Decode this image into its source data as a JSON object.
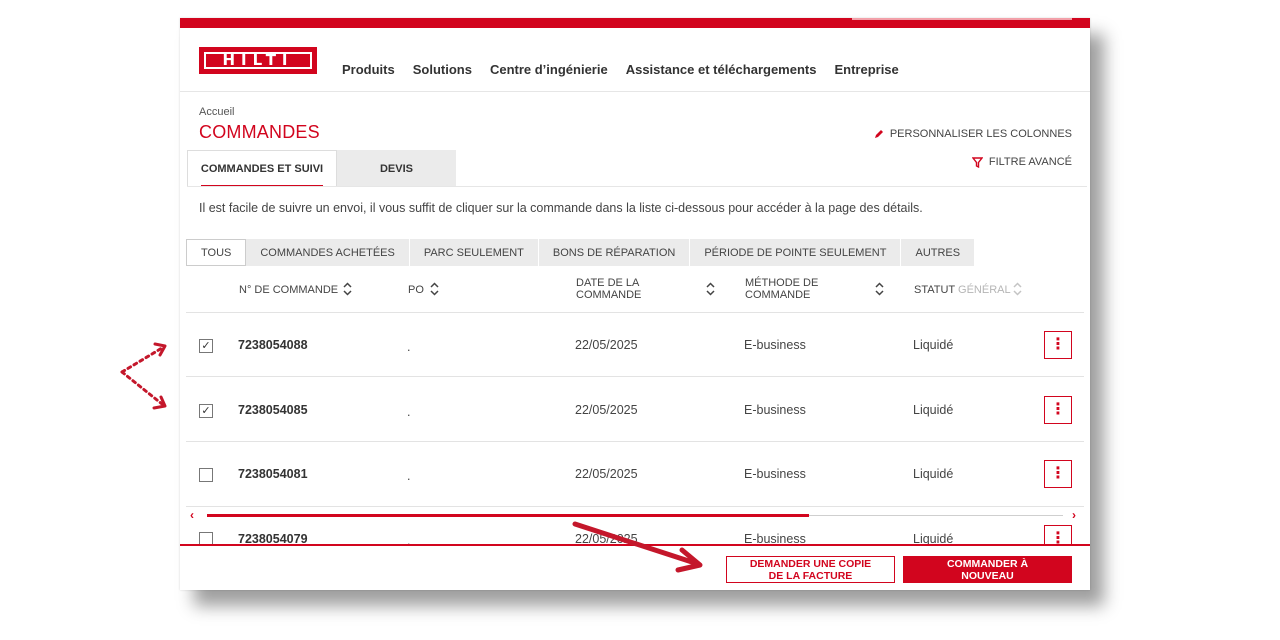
{
  "brand": {
    "logo_text": "HILTI",
    "accent": "#d2051e"
  },
  "nav": [
    "Produits",
    "Solutions",
    "Centre d’ingénierie",
    "Assistance et téléchargements",
    "Entreprise"
  ],
  "breadcrumb": "Accueil",
  "page_title": "COMMANDES",
  "actions": {
    "personalize": "PERSONNALISER LES COLONNES",
    "filter": "FILTRE AVANCÉ"
  },
  "tabs": [
    {
      "label": "COMMANDES ET SUIVI",
      "active": true
    },
    {
      "label": "DEVIS",
      "active": false
    }
  ],
  "info_text": "Il est facile de suivre un envoi, il vous suffit de cliquer sur la commande dans la liste ci-dessous pour accéder à la page des détails.",
  "filters": [
    {
      "label": "TOUS",
      "active": true
    },
    {
      "label": "COMMANDES ACHETÉES",
      "active": false
    },
    {
      "label": "PARC SEULEMENT",
      "active": false
    },
    {
      "label": "BONS DE RÉPARATION",
      "active": false
    },
    {
      "label": "PÉRIODE DE POINTE SEULEMENT",
      "active": false
    },
    {
      "label": "AUTRES",
      "active": false
    }
  ],
  "table": {
    "headers": {
      "order_no": "N° DE COMMANDE",
      "po": "PO",
      "date_line1": "DATE DE LA",
      "date_line2": "COMMANDE",
      "method_line1": "MÉTHODE DE",
      "method_line2": "COMMANDE",
      "status_a": "STATUT",
      "status_b": "GÉNÉRAL"
    },
    "rows": [
      {
        "checked": true,
        "number": "7238054088",
        "po": ".",
        "date": "22/05/2025",
        "method": "E-business",
        "status": "Liquidé"
      },
      {
        "checked": true,
        "number": "7238054085",
        "po": ".",
        "date": "22/05/2025",
        "method": "E-business",
        "status": "Liquidé"
      },
      {
        "checked": false,
        "number": "7238054081",
        "po": ".",
        "date": "22/05/2025",
        "method": "E-business",
        "status": "Liquidé"
      },
      {
        "checked": false,
        "number": "7238054079",
        "po": ".",
        "date": "22/05/2025",
        "method": "E-business",
        "status": "Liquidé"
      }
    ]
  },
  "footer": {
    "invoice_line1": "DEMANDER UNE COPIE",
    "invoice_line2": "DE LA FACTURE",
    "reorder_line1": "COMMANDER À",
    "reorder_line2": "NOUVEAU"
  }
}
